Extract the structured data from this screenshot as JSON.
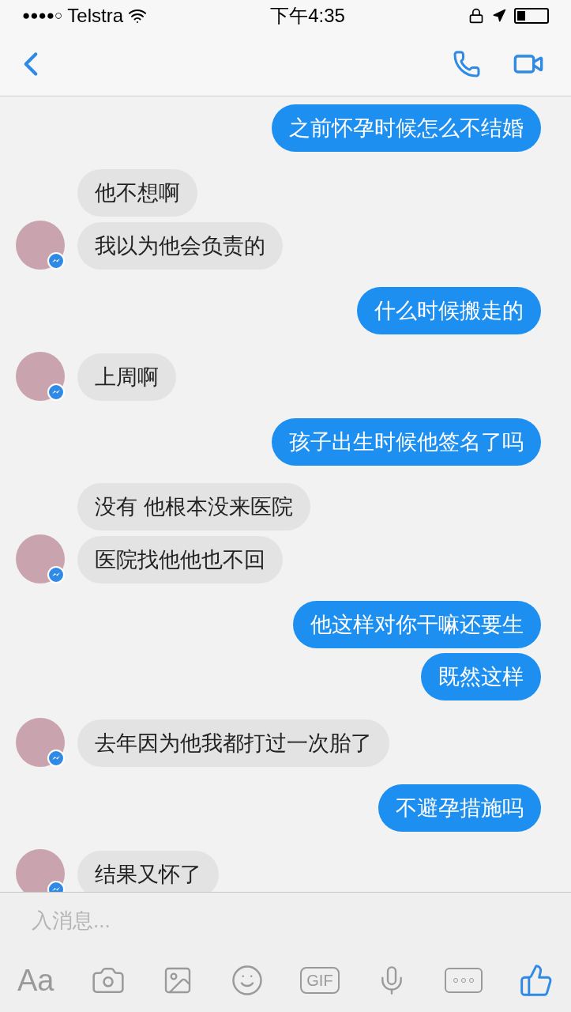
{
  "status_bar": {
    "signal": "●●●●○",
    "carrier": "Telstra",
    "time": "下午4:35"
  },
  "groups": [
    {
      "kind": "outgoing",
      "messages": [
        "之前怀孕时候怎么不结婚"
      ]
    },
    {
      "kind": "incoming",
      "messages": [
        "他不想啊",
        "我以为他会负责的"
      ]
    },
    {
      "kind": "outgoing",
      "messages": [
        "什么时候搬走的"
      ]
    },
    {
      "kind": "incoming",
      "messages": [
        "上周啊"
      ]
    },
    {
      "kind": "outgoing",
      "messages": [
        "孩子出生时候他签名了吗"
      ]
    },
    {
      "kind": "incoming",
      "messages": [
        "没有 他根本没来医院",
        "医院找他他也不回"
      ]
    },
    {
      "kind": "outgoing",
      "messages": [
        "他这样对你干嘛还要生",
        "既然这样"
      ]
    },
    {
      "kind": "incoming",
      "messages": [
        "去年因为他我都打过一次胎了"
      ]
    },
    {
      "kind": "outgoing",
      "messages": [
        "不避孕措施吗"
      ]
    },
    {
      "kind": "incoming",
      "messages": [
        "结果又怀了"
      ]
    }
  ],
  "composer": {
    "placeholder": "入消息..."
  },
  "toolbar": {
    "text_button": "Aa",
    "gif_button": "GIF"
  }
}
